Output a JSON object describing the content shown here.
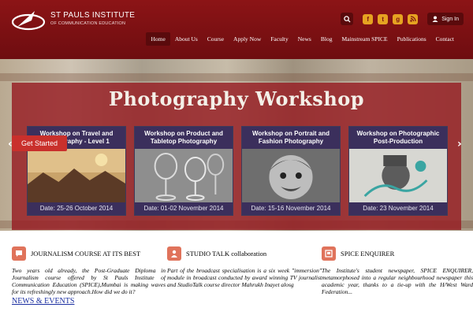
{
  "header": {
    "logo": {
      "line1": "ST PAULS INSTITUTE",
      "line2": "OF COMMUNICATION EDUCATION"
    },
    "social": [
      "f",
      "t",
      "g",
      "rss"
    ],
    "signin_label": "Sign In",
    "nav": [
      {
        "label": "Home",
        "active": true
      },
      {
        "label": "About Us"
      },
      {
        "label": "Course"
      },
      {
        "label": "Apply Now"
      },
      {
        "label": "Faculty"
      },
      {
        "label": "News"
      },
      {
        "label": "Blog"
      },
      {
        "label": "Mainstream SPICE"
      },
      {
        "label": "Publications"
      },
      {
        "label": "Contact"
      }
    ]
  },
  "hero": {
    "title": "Photography Workshop",
    "get_started": "Get Started",
    "cards": [
      {
        "title": "Workshop on Travel and Photography - Level 1",
        "date": "Date: 25-26 October 2014"
      },
      {
        "title": "Workshop on Product and Tabletop Photography",
        "date": "Date: 01-02 November 2014"
      },
      {
        "title": "Workshop on Portrait and Fashion Photography",
        "date": "Date: 15-16 November 2014"
      },
      {
        "title": "Workshop on Photographic Post-Production",
        "date": "Date: 23 November 2014"
      }
    ]
  },
  "features": [
    {
      "title": "JOURNALISM COURSE AT ITS BEST",
      "text": "Two years old already, the Post-Graduate Diploma in Journalism course offered by St Pauls Institute of Communication Education (SPICE),Mumbai is making waves for its refreshingly new approach.How did we do it?"
    },
    {
      "title": "STUDIO TALK collaboration",
      "text": "Part of the broadcast specialisation is a six week \"immersion\" module in broadcast conducted by award winning TV journalist and StudioTalk course director Mahrukh Inayet alosg"
    },
    {
      "title": "SPICE ENQUIRER",
      "text": "The Institute's student newspaper, SPICE ENQUIRER, metamorphosed into a regular neighbourhood newspaper this academic year, thanks to a tie-up with the H/West Ward Federation..."
    }
  ],
  "news_heading": "NEWS & EVENTS",
  "colors": {
    "header": "#7a1012",
    "accent": "#c9302c",
    "icon_orange": "#e0735b",
    "social": "#e6a321"
  }
}
